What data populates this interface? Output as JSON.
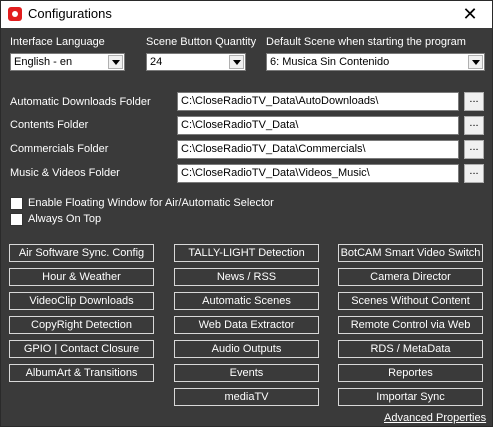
{
  "window": {
    "title": "Configurations",
    "close_glyph": "✕"
  },
  "language": {
    "label": "Interface Language",
    "value": "English - en"
  },
  "scene_qty": {
    "label": "Scene Button Quantity",
    "value": "24"
  },
  "default_scene": {
    "label": "Default Scene when starting the program",
    "value": "6: Musica Sin Contenido"
  },
  "folders": [
    {
      "label": "Automatic Downloads Folder",
      "path": "C:\\CloseRadioTV_Data\\AutoDownloads\\",
      "browse": "..."
    },
    {
      "label": "Contents Folder",
      "path": "C:\\CloseRadioTV_Data\\",
      "browse": "..."
    },
    {
      "label": "Commercials Folder",
      "path": "C:\\CloseRadioTV_Data\\Commercials\\",
      "browse": "..."
    },
    {
      "label": "Music & Videos Folder",
      "path": "C:\\CloseRadioTV_Data\\Videos_Music\\",
      "browse": "..."
    }
  ],
  "checkboxes": [
    {
      "label": "Enable Floating Window for Air/Automatic Selector",
      "checked": false
    },
    {
      "label": "Always On Top",
      "checked": false
    }
  ],
  "buttons": {
    "col1": [
      "Air Software Sync. Config",
      "Hour & Weather",
      "VideoClip Downloads",
      "CopyRight Detection",
      "GPIO | Contact Closure",
      "AlbumArt & Transitions"
    ],
    "col2": [
      "TALLY-LIGHT Detection",
      "News / RSS",
      "Automatic Scenes",
      "Web Data Extractor",
      "Audio Outputs",
      "Events",
      "mediaTV"
    ],
    "col3": [
      "BotCAM Smart Video Switch",
      "Camera Director",
      "Scenes Without Content",
      "Remote Control via Web",
      "RDS / MetaData",
      "Reportes",
      "Importar Sync"
    ]
  },
  "advanced_link": "Advanced Properties",
  "colors": {
    "background": "#3a3a3a",
    "titlebar": "#ffffff",
    "accent_icon": "#e21e1e"
  }
}
